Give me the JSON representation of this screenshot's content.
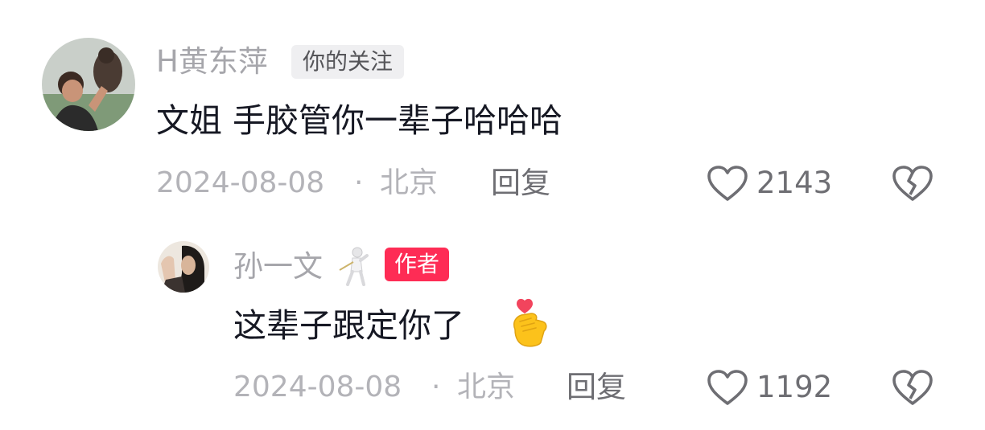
{
  "comment": {
    "username": "H黄东萍",
    "follow_tag": "你的关注",
    "text": "文姐 手胶管你一辈子哈哈哈",
    "date": "2024-08-08",
    "separator": "·",
    "location": "北京",
    "reply_label": "回复",
    "like_count": "2143",
    "avatar_icon": "user-avatar",
    "like_icon": "heart-outline-icon",
    "dislike_icon": "broken-heart-icon"
  },
  "reply": {
    "username": "孙一文",
    "username_badge_icon": "fencer-emoji-icon",
    "author_tag": "作者",
    "text": "这辈子跟定你了",
    "text_emoji_icon": "finger-heart-emoji-icon",
    "date": "2024-08-08",
    "separator": "·",
    "location": "北京",
    "reply_label": "回复",
    "like_count": "1192",
    "avatar_icon": "author-avatar",
    "like_icon": "heart-outline-icon",
    "dislike_icon": "broken-heart-icon"
  },
  "colors": {
    "author_tag_bg": "#fe2c55",
    "username": "#a6a6ab",
    "text": "#161823",
    "meta": "#b3b3b8"
  }
}
